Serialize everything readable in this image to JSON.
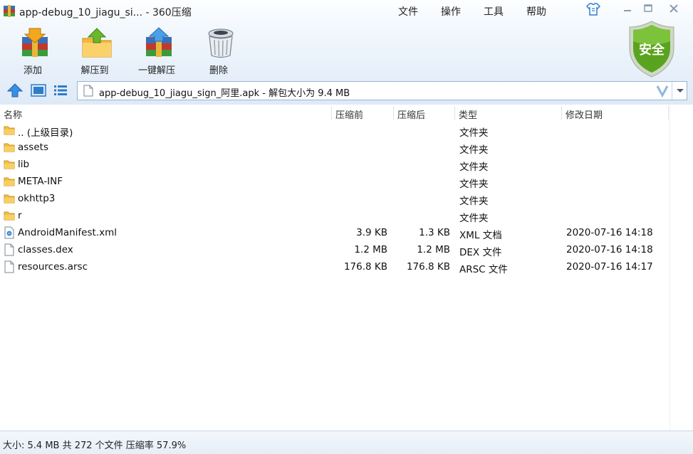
{
  "window": {
    "title": "app-debug_10_jiagu_si... - 360压缩"
  },
  "menu": [
    {
      "label": "文件"
    },
    {
      "label": "操作"
    },
    {
      "label": "工具"
    },
    {
      "label": "帮助"
    }
  ],
  "toolbar": [
    {
      "label": "添加",
      "icon": "add-archive-icon"
    },
    {
      "label": "解压到",
      "icon": "extract-to-icon"
    },
    {
      "label": "一键解压",
      "icon": "one-click-extract-icon"
    },
    {
      "label": "删除",
      "icon": "trash-icon"
    }
  ],
  "security_badge": {
    "label": "安全",
    "color": "#5aa31f"
  },
  "address": {
    "text": "app-debug_10_jiagu_sign_阿里.apk - 解包大小为 9.4 MB"
  },
  "columns": {
    "name": "名称",
    "original": "压缩前",
    "compressed": "压缩后",
    "type": "类型",
    "modified": "修改日期"
  },
  "files": [
    {
      "name": ".. (上级目录)",
      "original": "",
      "compressed": "",
      "type": "文件夹",
      "modified": "",
      "icon": "folder-icon"
    },
    {
      "name": "assets",
      "original": "",
      "compressed": "",
      "type": "文件夹",
      "modified": "",
      "icon": "folder-icon"
    },
    {
      "name": "lib",
      "original": "",
      "compressed": "",
      "type": "文件夹",
      "modified": "",
      "icon": "folder-icon"
    },
    {
      "name": "META-INF",
      "original": "",
      "compressed": "",
      "type": "文件夹",
      "modified": "",
      "icon": "folder-icon"
    },
    {
      "name": "okhttp3",
      "original": "",
      "compressed": "",
      "type": "文件夹",
      "modified": "",
      "icon": "folder-icon"
    },
    {
      "name": "r",
      "original": "",
      "compressed": "",
      "type": "文件夹",
      "modified": "",
      "icon": "folder-icon"
    },
    {
      "name": "AndroidManifest.xml",
      "original": "3.9 KB",
      "compressed": "1.3 KB",
      "type": "XML 文档",
      "modified": "2020-07-16 14:18",
      "icon": "xml-file-icon"
    },
    {
      "name": "classes.dex",
      "original": "1.2 MB",
      "compressed": "1.2 MB",
      "type": "DEX 文件",
      "modified": "2020-07-16 14:18",
      "icon": "file-icon"
    },
    {
      "name": "resources.arsc",
      "original": "176.8 KB",
      "compressed": "176.8 KB",
      "type": "ARSC 文件",
      "modified": "2020-07-16 14:17",
      "icon": "file-icon"
    }
  ],
  "status": {
    "text": "大小: 5.4 MB 共 272 个文件 压缩率 57.9%"
  }
}
